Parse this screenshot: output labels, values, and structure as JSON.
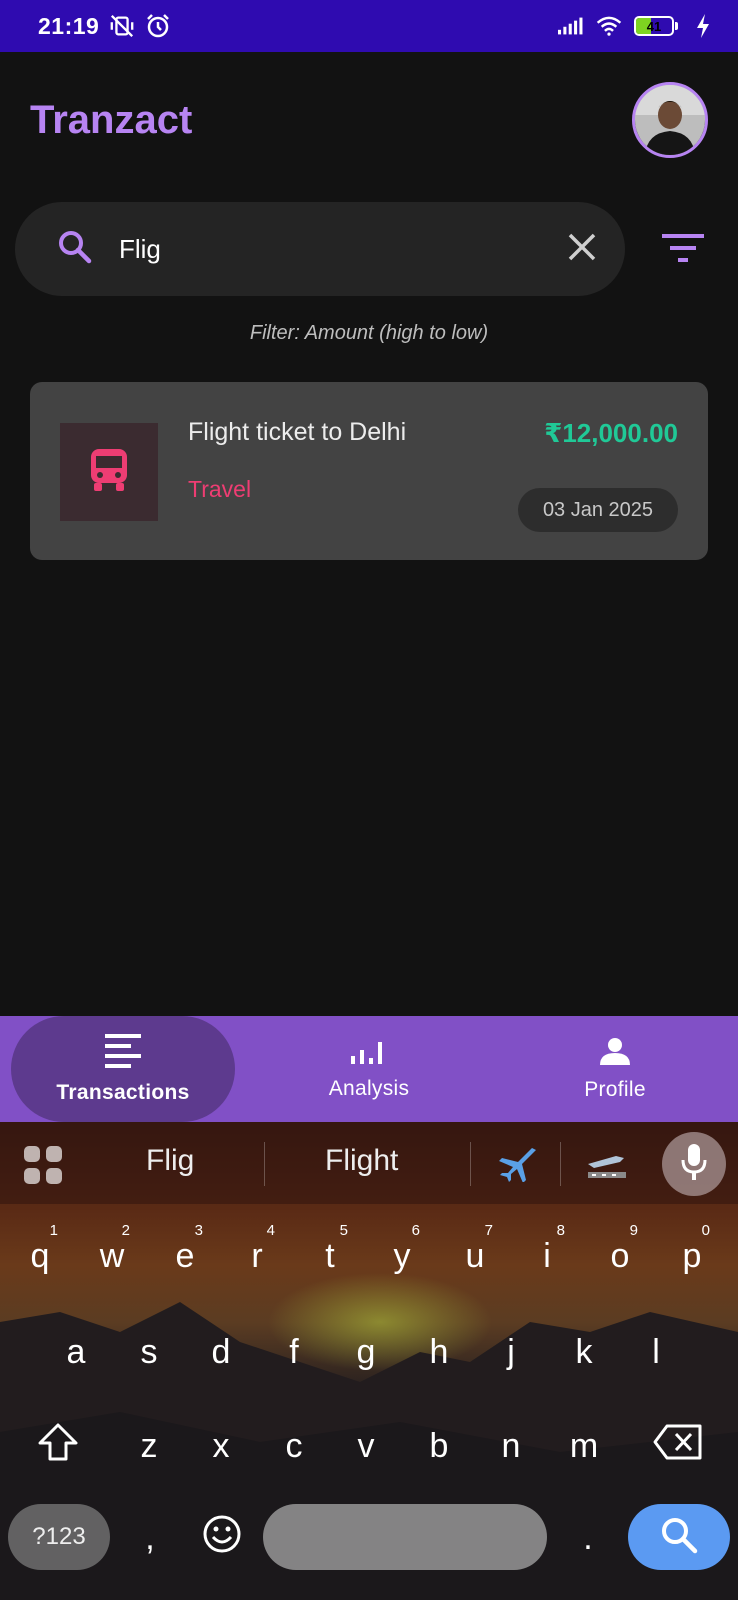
{
  "status_bar": {
    "time": "21:19",
    "battery_level": "41",
    "icons": [
      "dnd-vibrate-off-icon",
      "alarm-icon",
      "signal-icon",
      "wifi-icon",
      "battery-icon",
      "charging-icon"
    ]
  },
  "header": {
    "title": "Tranzact"
  },
  "search": {
    "query": "Flig",
    "icons": [
      "search-icon",
      "clear-icon",
      "filter-icon"
    ]
  },
  "filter_label": "Filter: Amount (high to low)",
  "transactions": [
    {
      "title": "Flight ticket to Delhi",
      "category": "Travel",
      "amount": "₹12,000.00",
      "date": "03 Jan 2025",
      "icon": "bus-icon"
    }
  ],
  "bottom_nav": {
    "items": [
      {
        "label": "Transactions",
        "icon": "list-icon",
        "active": true
      },
      {
        "label": "Analysis",
        "icon": "bar-chart-icon",
        "active": false
      },
      {
        "label": "Profile",
        "icon": "person-icon",
        "active": false
      }
    ]
  },
  "keyboard": {
    "suggestions": [
      "Flig",
      "Flight"
    ],
    "emoji_suggestions": [
      "airplane-emoji",
      "airplane-landing-emoji"
    ],
    "row1": [
      "q",
      "w",
      "e",
      "r",
      "t",
      "y",
      "u",
      "i",
      "o",
      "p"
    ],
    "row1_hints": [
      "1",
      "2",
      "3",
      "4",
      "5",
      "6",
      "7",
      "8",
      "9",
      "0"
    ],
    "row2": [
      "a",
      "s",
      "d",
      "f",
      "g",
      "h",
      "j",
      "k",
      "l"
    ],
    "row3": [
      "z",
      "x",
      "c",
      "v",
      "b",
      "n",
      "m"
    ],
    "symbols_key": "?123",
    "comma": ",",
    "period": "."
  },
  "colors": {
    "accent": "#b784f2",
    "status_bar": "#2f0bb0",
    "nav_bg": "#8150c6",
    "amount": "#20c997",
    "category": "#ee3d73"
  }
}
